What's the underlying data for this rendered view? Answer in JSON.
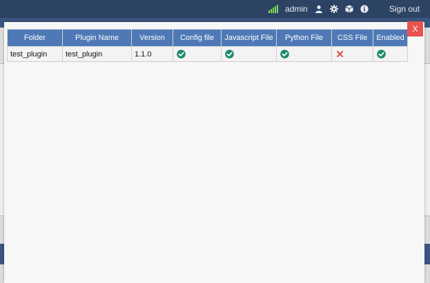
{
  "topbar": {
    "username": "admin",
    "signout_label": "Sign out",
    "icons": [
      "signal-icon",
      "user-icon",
      "gear-icon",
      "cube-icon",
      "info-icon"
    ]
  },
  "modal": {
    "close_label": "X",
    "table": {
      "headers": [
        "Folder",
        "Plugin Name",
        "Version",
        "Config file",
        "Javascript File",
        "Python File",
        "CSS File",
        "Enabled"
      ],
      "rows": [
        {
          "folder": "test_plugin",
          "plugin_name": "test_plugin",
          "version": "1.1.0",
          "config_file": "check-icon",
          "javascript_file": "check-icon",
          "python_file": "check-icon",
          "css_file": "cross-icon",
          "enabled": "check-icon"
        }
      ]
    }
  },
  "colors": {
    "navbar": "#2d4364",
    "table_header": "#4e79b6",
    "check": "#1e8a6e",
    "cross": "#d9534f",
    "close_button": "#e9534f"
  }
}
